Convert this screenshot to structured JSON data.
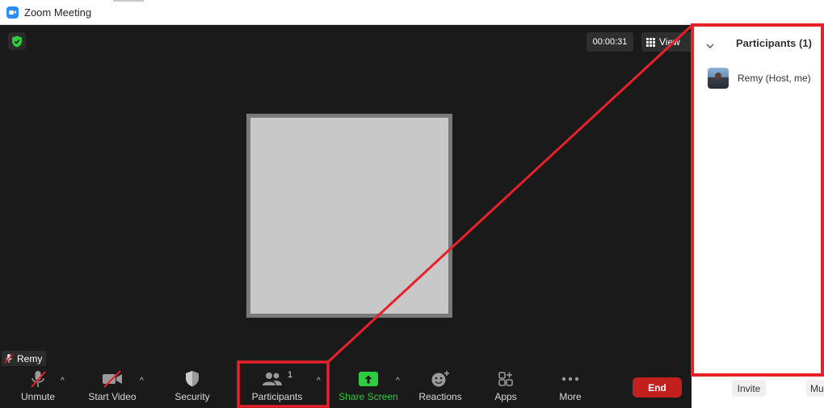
{
  "window": {
    "title": "Zoom Meeting"
  },
  "meeting": {
    "timer": "00:00:31",
    "view_label": "View",
    "self_name": "Remy"
  },
  "toolbar": {
    "unmute": "Unmute",
    "start_video": "Start Video",
    "security": "Security",
    "participants": "Participants",
    "participant_count": "1",
    "share_screen": "Share Screen",
    "reactions": "Reactions",
    "apps": "Apps",
    "more": "More",
    "end": "End"
  },
  "participants_panel": {
    "title": "Participants (1)",
    "participants": [
      {
        "name": "Remy (Host, me)"
      }
    ],
    "invite": "Invite",
    "mute_all": "Mu"
  },
  "colors": {
    "annotation": "#e8202a",
    "share_green": "#2ecc40",
    "end_red": "#c21f1f",
    "meeting_bg": "#1a1a1a"
  }
}
